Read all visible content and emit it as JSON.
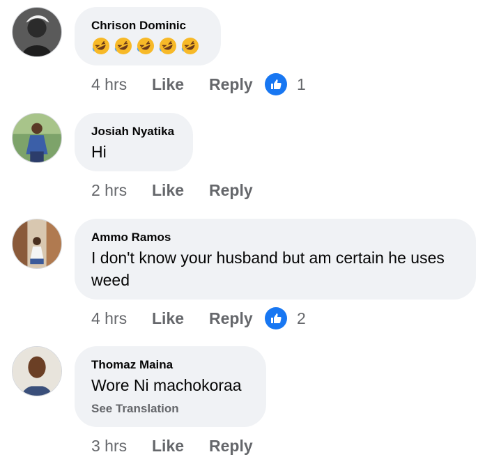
{
  "comments": [
    {
      "author": "Chrison Dominic",
      "text": "",
      "emoji_icon": "rolling-on-floor-laughing-icon",
      "emoji_count": 5,
      "time": "4 hrs",
      "like_label": "Like",
      "reply_label": "Reply",
      "reactions": "1"
    },
    {
      "author": "Josiah Nyatika",
      "text": "Hi",
      "time": "2 hrs",
      "like_label": "Like",
      "reply_label": "Reply"
    },
    {
      "author": "Ammo Ramos",
      "text": "I don't know your husband but am certain he uses weed",
      "time": "4 hrs",
      "like_label": "Like",
      "reply_label": "Reply",
      "reactions": "2"
    },
    {
      "author": "Thomaz Maina",
      "text": "Wore Ni machokoraa",
      "see_translation": "See Translation",
      "time": "3 hrs",
      "like_label": "Like",
      "reply_label": "Reply"
    }
  ],
  "colors": {
    "bubble": "#f0f2f5",
    "like_blue": "#1877f2",
    "meta_gray": "#65676b",
    "text": "#050505"
  }
}
